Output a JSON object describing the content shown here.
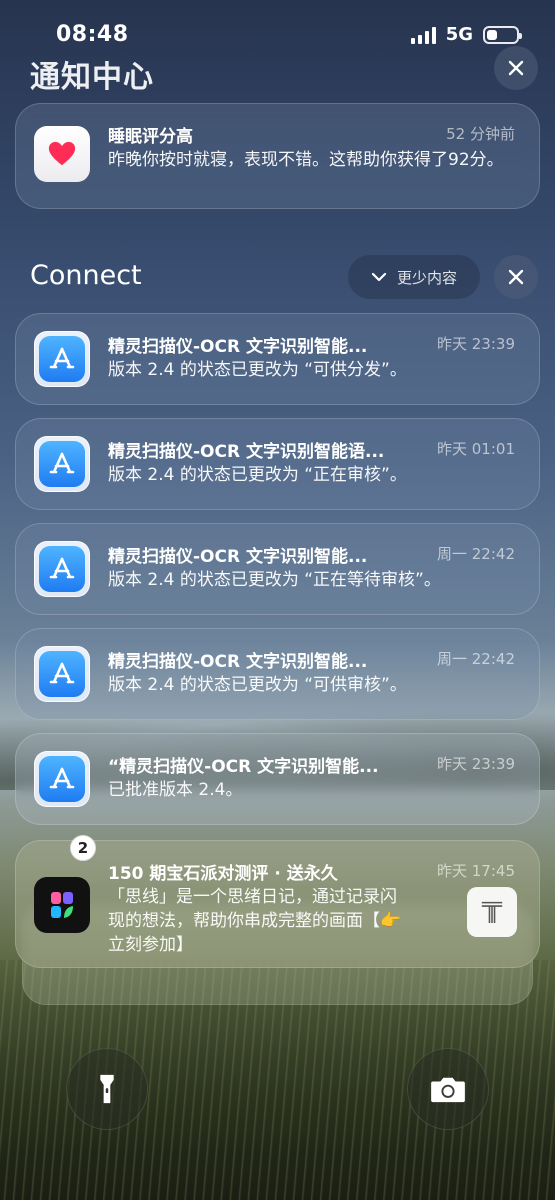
{
  "status_bar": {
    "time": "08:48",
    "network": "5G"
  },
  "header": {
    "title": "通知中心"
  },
  "notifications_top": {
    "app": "health",
    "title": "睡眠评分高",
    "time": "52 分钟前",
    "body": "昨晚你按时就寝，表现不错。这帮助你获得了92分。"
  },
  "group": {
    "name": "Connect",
    "show_less_label": "更少内容",
    "items": [
      {
        "title": "精灵扫描仪-OCR 文字识别智能...",
        "time": "昨天 23:39",
        "body": "版本 2.4 的状态已更改为 “可供分发”。"
      },
      {
        "title": "精灵扫描仪-OCR 文字识别智能语...",
        "time": "昨天 01:01",
        "body": "版本 2.4 的状态已更改为 “正在审核”。"
      },
      {
        "title": "精灵扫描仪-OCR 文字识别智能...",
        "time": "周一 22:42",
        "body": "版本 2.4 的状态已更改为 “正在等待审核”。"
      },
      {
        "title": "精灵扫描仪-OCR 文字识别智能...",
        "time": "周一 22:42",
        "body": "版本 2.4 的状态已更改为 “可供审核”。"
      },
      {
        "title": "“精灵扫描仪-OCR 文字识别智能...",
        "time": "昨天 23:39",
        "body": "已批准版本 2.4。"
      }
    ]
  },
  "stacked_notification": {
    "badge": "2",
    "title": "150 期宝石派对测评 · 送永久",
    "time": "昨天 17:45",
    "body_line1": "「思线」是一个思绪日记，通过记录闪",
    "body_line2": "现的想法，帮助你串成完整的画面【👉",
    "body_line3": "立刻参加】"
  },
  "icons": {
    "close": "close-icon",
    "health": "heart-icon",
    "app_store": "app-store-icon",
    "flashlight": "flashlight-icon",
    "camera": "camera-icon"
  },
  "colors": {
    "heart": "#ff2d55",
    "app_store_blue": "#1f7cf2"
  }
}
